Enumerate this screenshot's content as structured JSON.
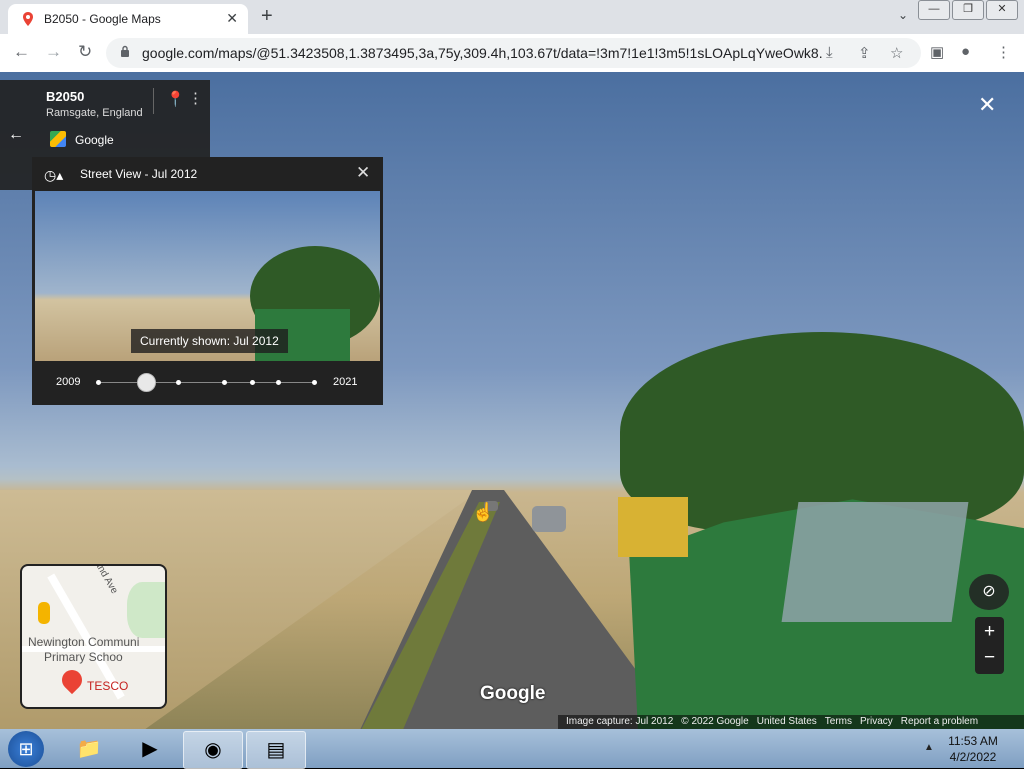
{
  "browser": {
    "tab_title": "B2050 - Google Maps",
    "tab_close": "✕",
    "new_tab": "+",
    "url": "google.com/maps/@51.3423508,1.3873495,3a,75y,309.4h,103.67t/data=!3m7!1e1!3m5!1sLOApLqYweOwk8...",
    "nav": {
      "back": "←",
      "forward": "→",
      "reload": "↻"
    }
  },
  "street_view": {
    "close": "✕",
    "watermark": "Google",
    "compass": "⊘"
  },
  "address_card": {
    "title": "B2050",
    "subtitle": "Ramsgate, England",
    "provider": "Google"
  },
  "time_travel": {
    "title": "Street View - Jul 2012",
    "tooltip": "Currently shown: Jul 2012",
    "start_year": "2009",
    "end_year": "2021",
    "slider_position": 0.22
  },
  "minimap": {
    "labels": [
      "Newington Communi",
      "Primary Schoo",
      "and Ave"
    ],
    "place": "TESCO"
  },
  "zoom": {
    "in": "+",
    "out": "−"
  },
  "attribution": [
    "Image capture: Jul 2012",
    "© 2022 Google",
    "United States",
    "Terms",
    "Privacy",
    "Report a problem"
  ],
  "taskbar": {
    "time": "11:53 AM",
    "date": "4/2/2022"
  }
}
